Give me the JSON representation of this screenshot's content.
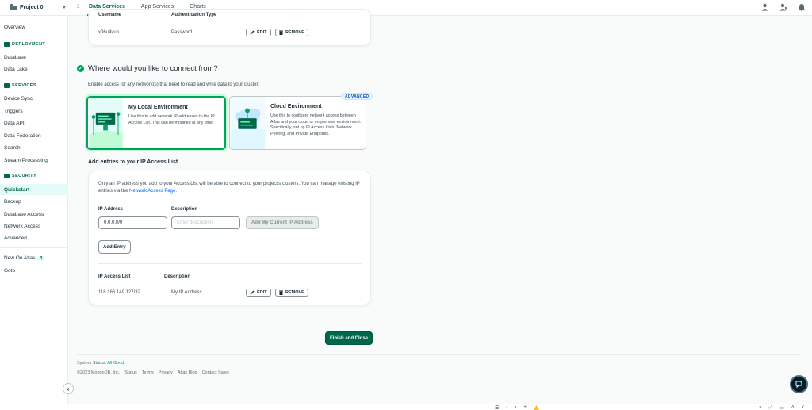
{
  "topbar": {
    "project": "Project 0",
    "tabs": [
      {
        "label": "Data Services",
        "active": true
      },
      {
        "label": "App Services",
        "active": false
      },
      {
        "label": "Charts",
        "active": false
      }
    ]
  },
  "sidebar": {
    "overview": "Overview",
    "deployment_heading": "DEPLOYMENT",
    "deployment_items": [
      "Database",
      "Data Lake"
    ],
    "services_heading": "SERVICES",
    "services_items": [
      "Device Sync",
      "Triggers",
      "Data API",
      "Data Federation",
      "Search",
      "Stream Processing"
    ],
    "security_heading": "SECURITY",
    "security_items": [
      "Quickstart",
      "Backup",
      "Database Access",
      "Network Access",
      "Advanced"
    ],
    "new_on_atlas": "New On Atlas",
    "new_on_atlas_count": "3",
    "goto": "Goto"
  },
  "users_card": {
    "col_username": "Username",
    "col_auth": "Authentication Type",
    "row": {
      "username": "x06u4vup",
      "auth": "Password"
    },
    "edit_label": "EDIT",
    "remove_label": "REMOVE"
  },
  "connect": {
    "heading": "Where would you like to connect from?",
    "description": "Enable access for any network(s) that need to read and write data to your cluster.",
    "local": {
      "title": "My Local Environment",
      "desc": "Use this to add network IP addresses to the IP Access List. This can be modified at any time."
    },
    "cloud": {
      "title": "Cloud Environment",
      "desc": "Use this to configure network access between Atlas and your cloud or on-premise environment. Specifically, set up IP Access Lists, Network Peering, and Private Endpoints.",
      "badge": "ADVANCED"
    }
  },
  "ip_access": {
    "heading": "Add entries to your IP Access List",
    "info_prefix": "Only an IP address you add to your Access List will be able to connect to your project's clusters. You can manage existing IP entries via the",
    "info_link": "Network Access Page",
    "info_suffix": ".",
    "ip_label": "IP Address",
    "desc_label": "Description",
    "ip_value": "0.0.0.0/0",
    "desc_placeholder": "Enter description",
    "add_current_ip": "Add My Current IP Address",
    "add_entry": "Add Entry",
    "list_col_ip": "IP Access List",
    "list_col_desc": "Description",
    "list_row": {
      "ip": "118.166.149.127/32",
      "desc": "My IP Address"
    },
    "edit_label": "EDIT",
    "remove_label": "REMOVE"
  },
  "finish_label": "Finish and Close",
  "footer": {
    "status_prefix": "System Status:",
    "status_value": "All Good",
    "copyright": "©2023 MongoDB, Inc.",
    "links": [
      "Status",
      "Terms",
      "Privacy",
      "Atlas Blog",
      "Contact Sales"
    ]
  },
  "colors": {
    "brand_green": "#00684a",
    "accent_green": "#00a35c",
    "link_blue": "#016bf8",
    "text": "#1c2d38"
  }
}
